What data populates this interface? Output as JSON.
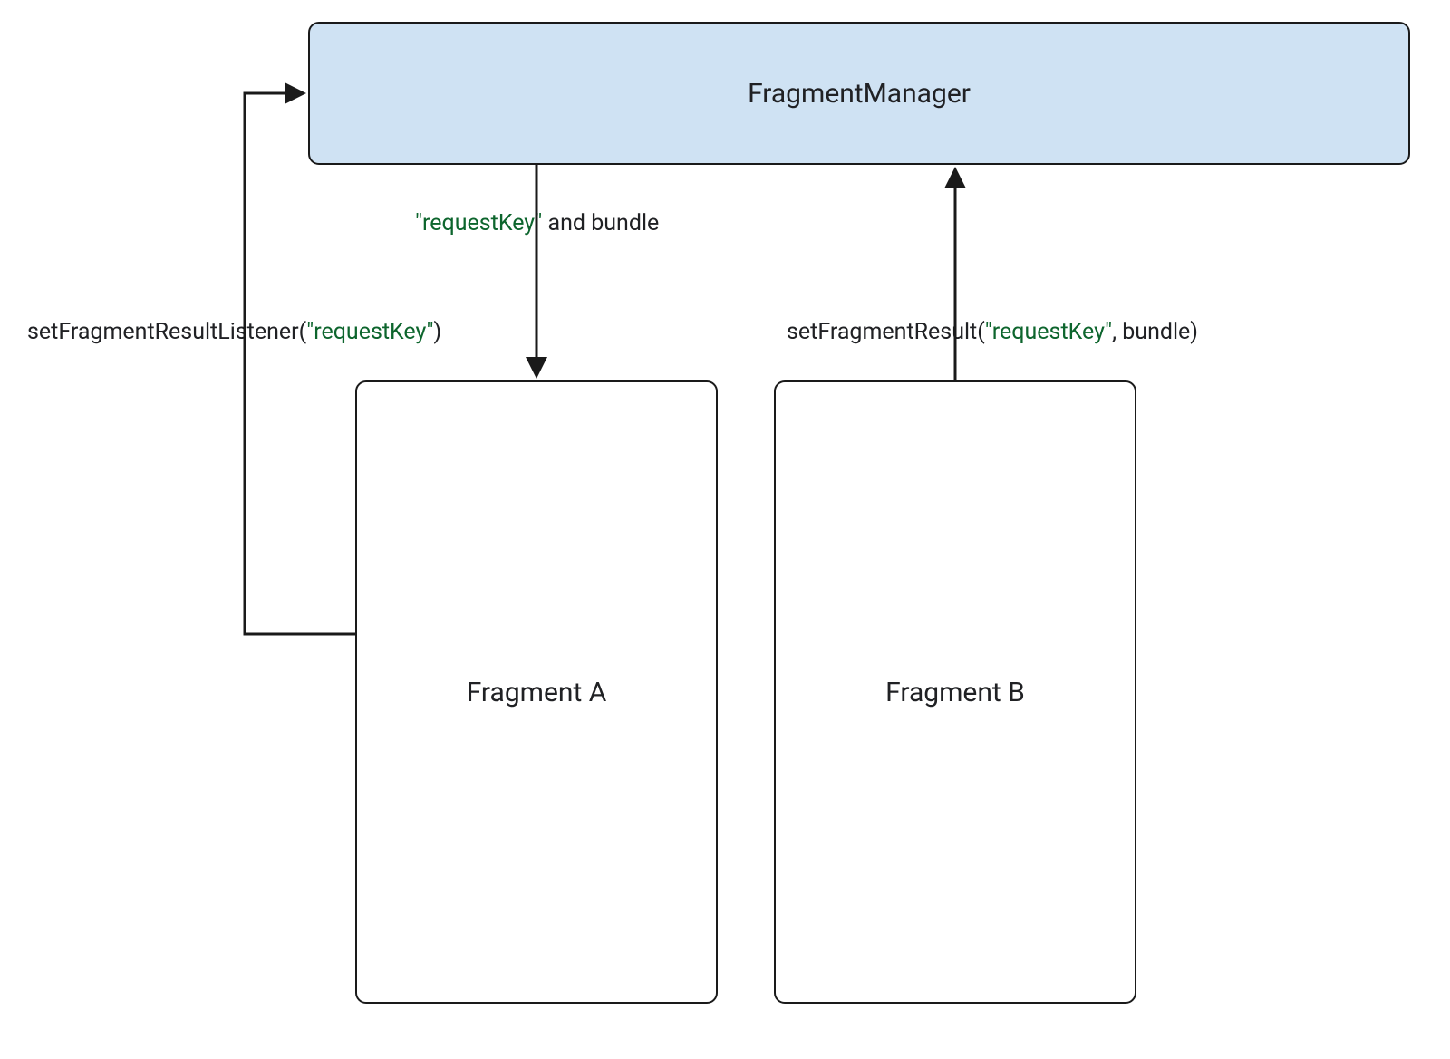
{
  "boxes": {
    "manager": {
      "label": "FragmentManager"
    },
    "fragA": {
      "label": "Fragment A"
    },
    "fragB": {
      "label": "Fragment B"
    }
  },
  "labels": {
    "listener": {
      "prefix": "setFragmentResultListener(",
      "key": "\"requestKey\"",
      "suffix": ")"
    },
    "bundle": {
      "key": "\"requestKey\"",
      "suffix": " and bundle"
    },
    "setResult": {
      "prefix": "setFragmentResult(",
      "key": "\"requestKey\"",
      "suffix": ", bundle)"
    }
  },
  "colors": {
    "managerFill": "#cfe2f3",
    "stroke": "#1a1a1a",
    "string": "#0d652d"
  }
}
